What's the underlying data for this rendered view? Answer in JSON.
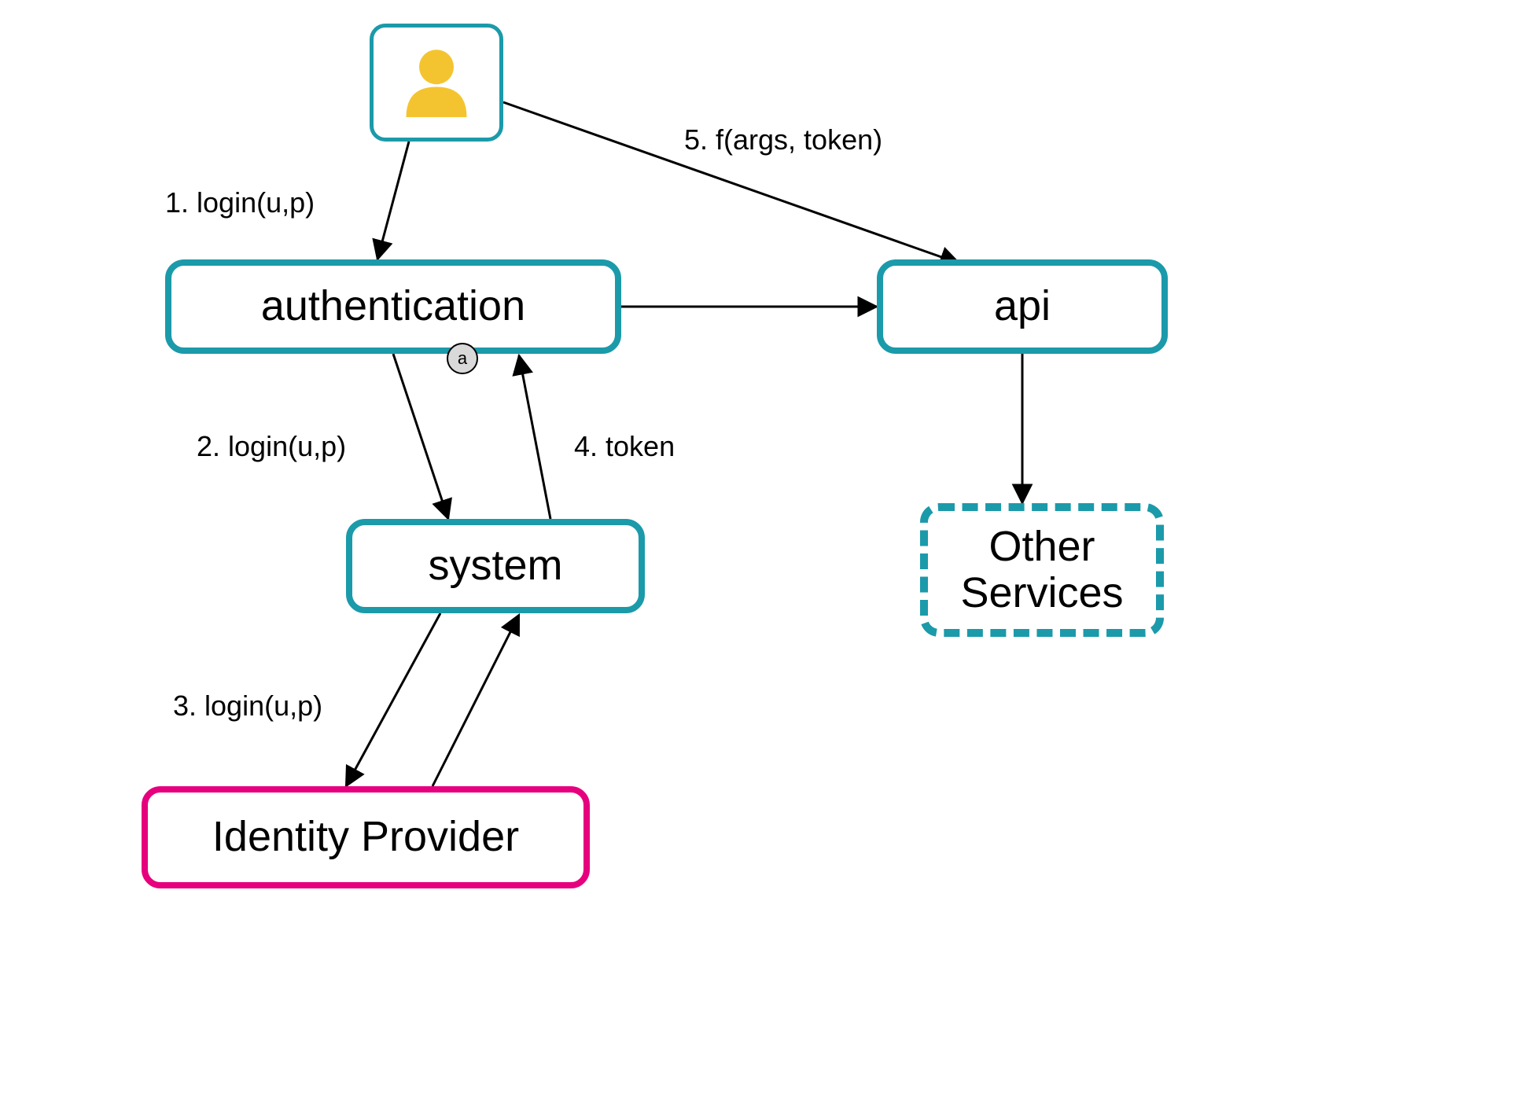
{
  "colors": {
    "teal": "#1b9aaa",
    "pink": "#e6007e",
    "user_fill": "#f4c430",
    "port_fill": "#d9d9d9"
  },
  "nodes": {
    "user": {
      "label": ""
    },
    "authentication": {
      "label": "authentication",
      "port": "a"
    },
    "api": {
      "label": "api"
    },
    "system": {
      "label": "system"
    },
    "other_services": {
      "label": "Other\nServices"
    },
    "identity_provider": {
      "label": "Identity Provider"
    }
  },
  "edges": {
    "user_to_auth": {
      "label": "1. login(u,p)"
    },
    "auth_to_system": {
      "label": "2. login(u,p)"
    },
    "system_to_idp": {
      "label": "3. login(u,p)"
    },
    "system_to_auth": {
      "label": "4. token"
    },
    "user_to_api": {
      "label": "5. f(args, token)"
    },
    "api_to_other": {
      "label": ""
    },
    "auth_to_api": {
      "label": ""
    }
  }
}
